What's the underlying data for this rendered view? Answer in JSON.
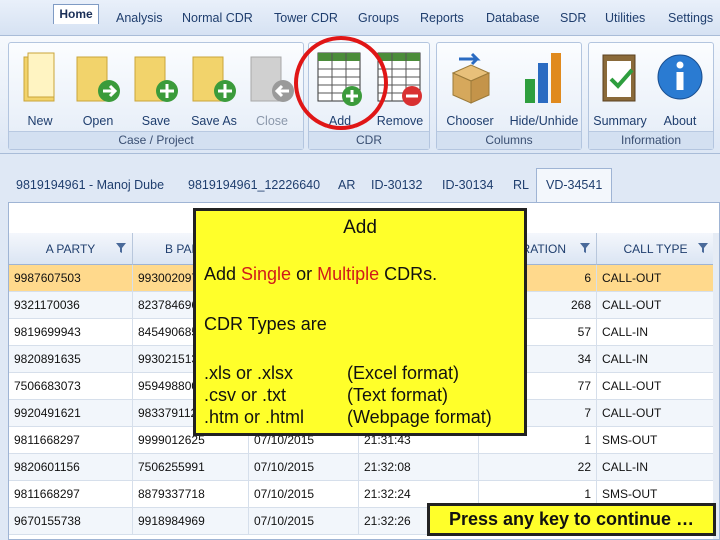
{
  "menu": {
    "home": "Home",
    "items": [
      "Analysis",
      "Normal CDR",
      "Tower CDR",
      "Groups",
      "Reports",
      "Database",
      "SDR",
      "Utilities",
      "Settings"
    ]
  },
  "ribbon": {
    "groups": [
      {
        "label": "Case / Project",
        "buttons": [
          "New",
          "Open",
          "Save",
          "Save As",
          "Close"
        ]
      },
      {
        "label": "CDR",
        "buttons": [
          "Add",
          "Remove"
        ]
      },
      {
        "label": "Columns",
        "buttons": [
          "Chooser",
          "Hide/Unhide"
        ]
      },
      {
        "label": "Information",
        "buttons": [
          "Summary",
          "About"
        ]
      }
    ]
  },
  "tabs": [
    "9819194961 - Manoj Dube",
    "9819194961_12226640",
    "AR",
    "ID-30132",
    "ID-30134",
    "RL",
    "VD-34541"
  ],
  "grid": {
    "columns": [
      "A PARTY",
      "B PAR",
      "DURATION",
      "CALL TYPE"
    ],
    "rows": [
      {
        "a": "9987607503",
        "b": "993002097",
        "date": "",
        "time": "",
        "dur": "6",
        "type": "CALL-OUT"
      },
      {
        "a": "9321170036",
        "b": "823784696",
        "date": "",
        "time": "",
        "dur": "268",
        "type": "CALL-OUT"
      },
      {
        "a": "9819699943",
        "b": "845490685",
        "date": "",
        "time": "",
        "dur": "57",
        "type": "CALL-IN"
      },
      {
        "a": "9820891635",
        "b": "993021513",
        "date": "",
        "time": "",
        "dur": "34",
        "type": "CALL-IN"
      },
      {
        "a": "7506683073",
        "b": "959498800",
        "date": "",
        "time": "",
        "dur": "77",
        "type": "CALL-OUT"
      },
      {
        "a": "9920491621",
        "b": "983379112",
        "date": "",
        "time": "",
        "dur": "7",
        "type": "CALL-OUT"
      },
      {
        "a": "9811668297",
        "b": "9999012625",
        "date": "07/10/2015",
        "time": "21:31:43",
        "dur": "1",
        "type": "SMS-OUT"
      },
      {
        "a": "9820601156",
        "b": "7506255991",
        "date": "07/10/2015",
        "time": "21:32:08",
        "dur": "22",
        "type": "CALL-IN"
      },
      {
        "a": "9811668297",
        "b": "8879337718",
        "date": "07/10/2015",
        "time": "21:32:24",
        "dur": "1",
        "type": "SMS-OUT"
      },
      {
        "a": "9670155738",
        "b": "9918984969",
        "date": "07/10/2015",
        "time": "21:32:26",
        "dur": "",
        "type": ""
      }
    ]
  },
  "overlay": {
    "title": "Add",
    "line1_pre": "Add ",
    "line1_single": "Single",
    "line1_or": " or ",
    "line1_multiple": "Multiple",
    "line1_post": " CDRs.",
    "types_heading": "CDR Types are",
    "formats": [
      {
        "ext": ".xls or .xlsx",
        "desc": "(Excel format)"
      },
      {
        "ext": ".csv or .txt",
        "desc": "(Text format)"
      },
      {
        "ext": ".htm or .html",
        "desc": "(Webpage format)"
      }
    ]
  },
  "continue_prompt": "Press any key to continue …",
  "colors": {
    "highlight": "#e01616",
    "overlay": "#ffff2a",
    "selected_row": "#ffd98c"
  }
}
